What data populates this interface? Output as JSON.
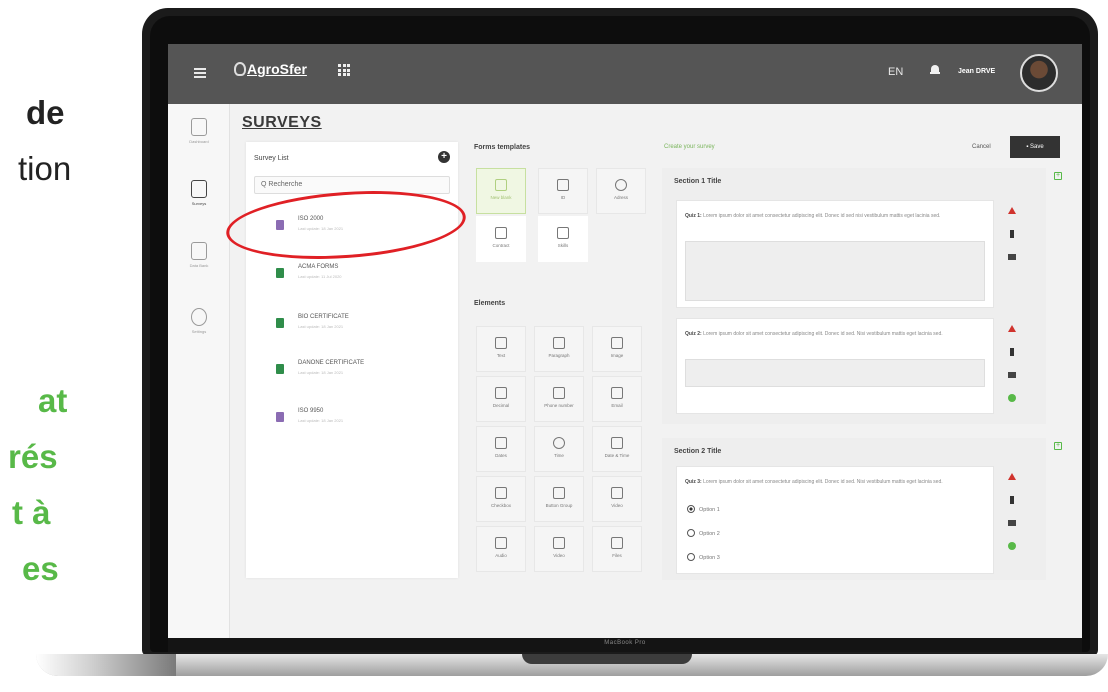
{
  "side_text": {
    "line1": "de",
    "line2": "tion",
    "green1": "at",
    "green2": "rés",
    "green3": "t à",
    "green4": "es"
  },
  "laptop": {
    "model": "MacBook Pro"
  },
  "topbar": {
    "logo": "AgroSfer",
    "language": "EN",
    "user": "Jean DRVE"
  },
  "leftnav": [
    {
      "label": "Dashboard"
    },
    {
      "label": "Surveys"
    },
    {
      "label": "Data Bank"
    },
    {
      "label": "Settings"
    }
  ],
  "page_title": "SURVEYS",
  "survey_list": {
    "title": "Survey List",
    "search_placeholder": "Q  Recherche",
    "items": [
      {
        "name": "ISO 2000",
        "sub": "Last update: 18 Jan 2021",
        "color": "#8b6cb3"
      },
      {
        "name": "ACMA FORMS",
        "sub": "Last update: 11 Jul 2020",
        "color": "#2f8d4a"
      },
      {
        "name": "BIO CERTIFICATE",
        "sub": "Last update: 18 Jan 2021",
        "color": "#2f8d4a"
      },
      {
        "name": "DANONE CERTIFICATE",
        "sub": "Last update: 18 Jan 2021",
        "color": "#2f8d4a"
      },
      {
        "name": "ISO 9950",
        "sub": "Last update: 18 Jan 2021",
        "color": "#8b6cb3"
      }
    ]
  },
  "templates": {
    "title": "Forms templates",
    "items": [
      {
        "label": "New blank"
      },
      {
        "label": "ID"
      },
      {
        "label": "Adress"
      },
      {
        "label": "Contract"
      },
      {
        "label": "Skills"
      }
    ]
  },
  "elements": {
    "title": "Elements",
    "items": [
      {
        "label": "Text"
      },
      {
        "label": "Paragraph"
      },
      {
        "label": "Image"
      },
      {
        "label": "Decimal"
      },
      {
        "label": "Phone number"
      },
      {
        "label": "Email"
      },
      {
        "label": "Dates"
      },
      {
        "label": "Time"
      },
      {
        "label": "Date & Time"
      },
      {
        "label": "Checkbox"
      },
      {
        "label": "Button Group"
      },
      {
        "label": "Video"
      },
      {
        "label": "Audio"
      },
      {
        "label": "Video"
      },
      {
        "label": "Files"
      }
    ]
  },
  "create": {
    "title": "Create your survey",
    "cancel": "Cancel",
    "save": "Save",
    "section1": {
      "title": "Section 1 Title",
      "q1_label": "Quiz 1:",
      "q1_text": "Lorem ipsum dolor sit amet consectetur adipiscing elit. Donec id sed nisi vestibulum mattis eget lacinia sed.",
      "q2_label": "Quiz 2:",
      "q2_text": "Lorem ipsum dolor sit amet consectetur adipiscing elit. Donec id sed. Nisi vestibulum mattis eget lacinia sed."
    },
    "section2": {
      "title": "Section 2 Title",
      "q3_label": "Quiz 3:",
      "q3_text": "Lorem ipsum dolor sit amet consectetur adipiscing elit. Donec id sed. Nisi vestibulum mattis eget lacinia sed.",
      "options": [
        "Option 1",
        "Option 2",
        "Option 3"
      ]
    }
  },
  "colors": {
    "accent_green": "#58b948",
    "highlight_red": "#e02025",
    "topbar": "#555555"
  }
}
